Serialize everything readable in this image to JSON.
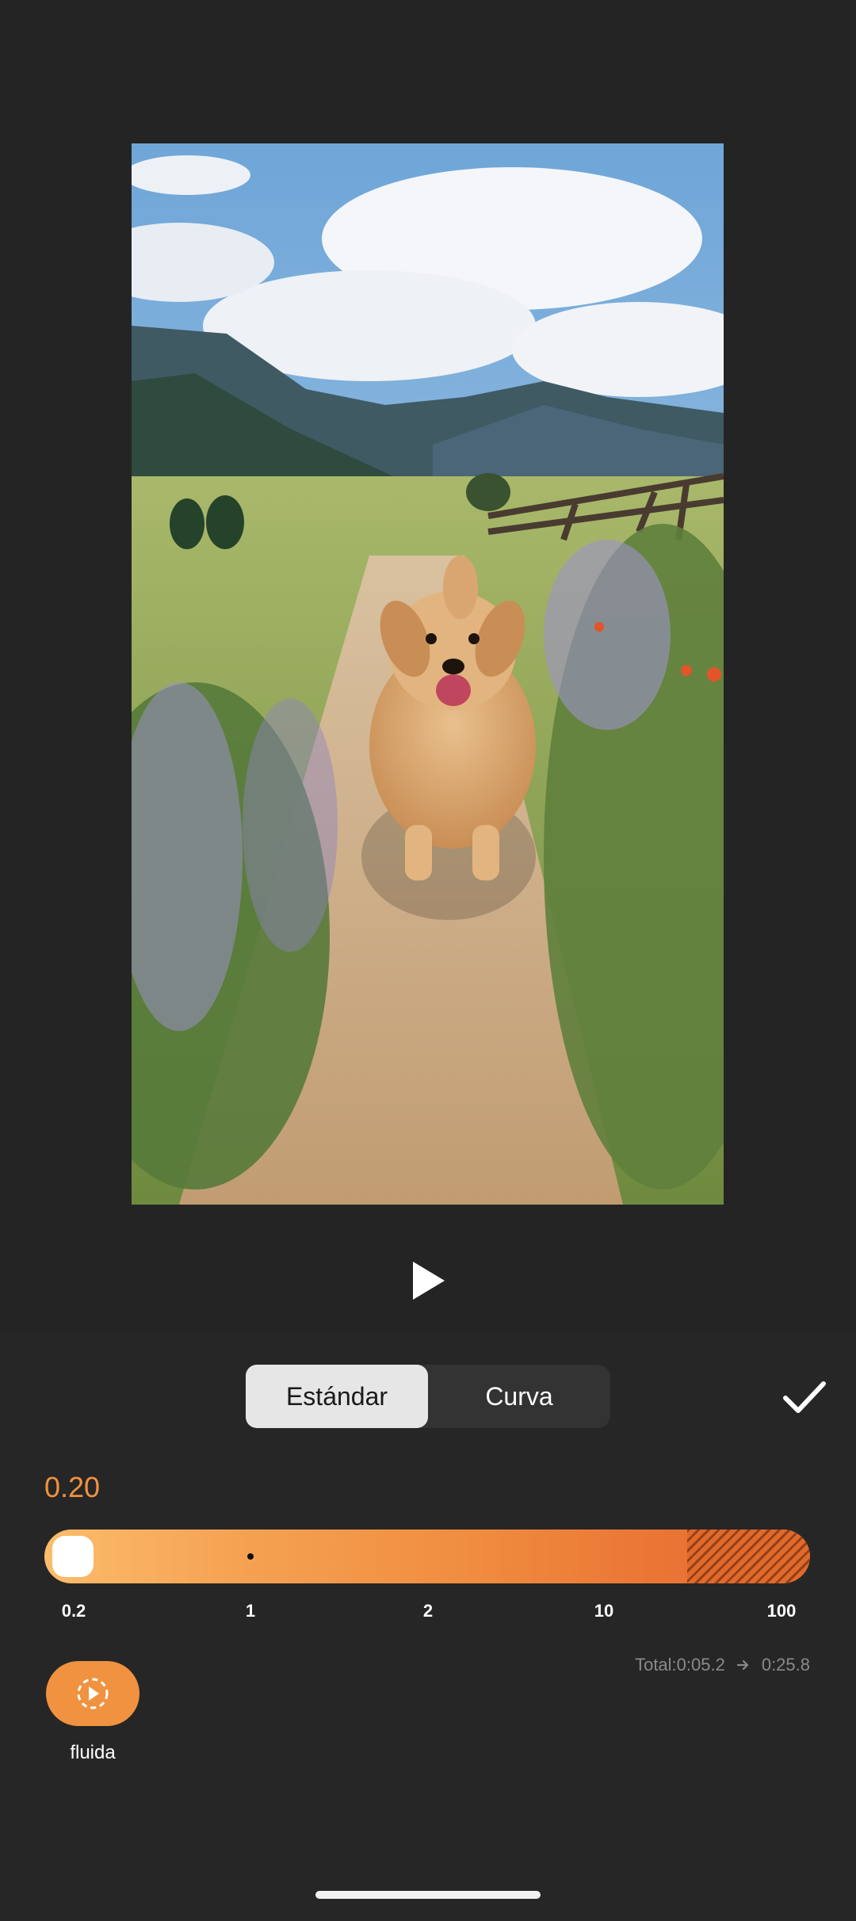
{
  "mode_toggle": {
    "standard_label": "Estándar",
    "curve_label": "Curva",
    "selected": "Estándar"
  },
  "speed": {
    "current_value": "0.20",
    "slider_fraction": 0.0,
    "ticks": [
      "0.2",
      "1",
      "2",
      "10",
      "100"
    ]
  },
  "duration": {
    "total_label": "Total:0:05.2",
    "new_value": "0:25.8"
  },
  "smooth_button": {
    "label": "fluida"
  },
  "icons": {
    "play": "play-icon",
    "confirm": "checkmark-icon",
    "arrow": "arrow-right-icon",
    "smooth": "smooth-playback-icon"
  },
  "colors": {
    "accent": "#f0923f",
    "background": "#262626",
    "segment_active": "#e6e6e6"
  }
}
